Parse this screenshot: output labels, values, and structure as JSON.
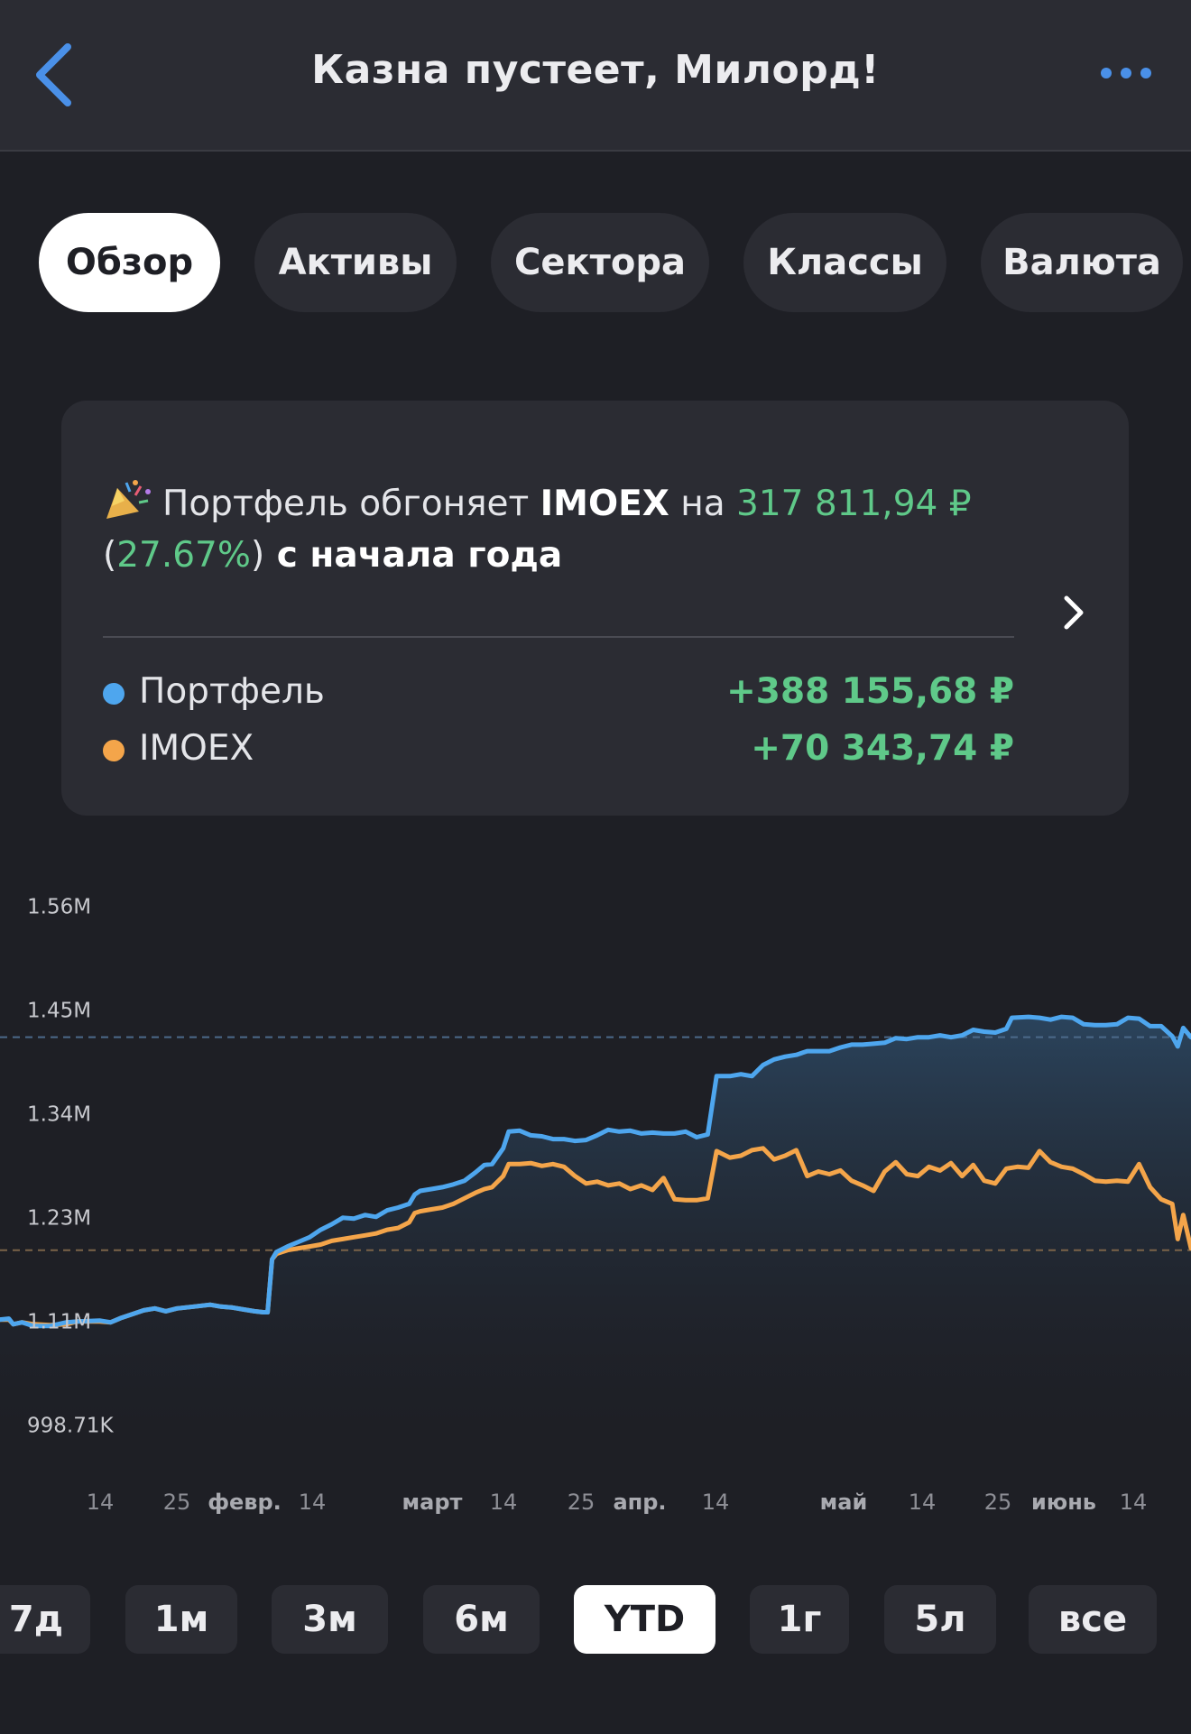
{
  "header": {
    "title": "Казна пустеет, Милорд!",
    "back_icon": "chevron-left-icon",
    "more_icon": "more-horizontal-icon"
  },
  "tabs": [
    {
      "label": "Обзор",
      "active": true
    },
    {
      "label": "Активы",
      "active": false
    },
    {
      "label": "Сектора",
      "active": false
    },
    {
      "label": "Классы",
      "active": false
    },
    {
      "label": "Валюта",
      "active": false
    }
  ],
  "summary": {
    "icon": "party-popper-icon",
    "prefix": "Портфель обгоняет ",
    "index": "IMOEX",
    "middle": " на ",
    "amount": "317 811,94 ₽",
    "open_paren": "(",
    "percent": "27.67%",
    "close_paren": ")",
    "suffix": " с начала года",
    "legend": [
      {
        "name": "Портфель",
        "value": "+388 155,68 ₽",
        "color": "#4ea6ee"
      },
      {
        "name": "IMOEX",
        "value": "+70 343,74 ₽",
        "color": "#f4a54a"
      }
    ]
  },
  "chart_data": {
    "type": "line",
    "y_ticks": [
      "1.56M",
      "1.45M",
      "1.34M",
      "1.23M",
      "1.11M",
      "998.71K"
    ],
    "x_ticks": [
      "14",
      "25",
      "февр.",
      "14",
      "март",
      "14",
      "25",
      "апр.",
      "14",
      "май",
      "14",
      "25",
      "июнь",
      "14"
    ],
    "ylim": [
      998710,
      1560000
    ],
    "reference_lines": [
      1420000,
      1190000
    ],
    "series": [
      {
        "name": "Портфель",
        "color": "#4ea6ee",
        "points": [
          [
            0,
            1115000
          ],
          [
            8,
            1116000
          ],
          [
            12,
            1110000
          ],
          [
            20,
            1112000
          ],
          [
            30,
            1108000
          ],
          [
            45,
            1108000
          ],
          [
            60,
            1112000
          ],
          [
            70,
            1113000
          ],
          [
            90,
            1114000
          ],
          [
            100,
            1112000
          ],
          [
            110,
            1117000
          ],
          [
            120,
            1121000
          ],
          [
            130,
            1125000
          ],
          [
            140,
            1127000
          ],
          [
            150,
            1124000
          ],
          [
            160,
            1127000
          ],
          [
            175,
            1129000
          ],
          [
            190,
            1131000
          ],
          [
            200,
            1129000
          ],
          [
            210,
            1128000
          ],
          [
            220,
            1126000
          ],
          [
            230,
            1124000
          ],
          [
            238,
            1123000
          ],
          [
            242,
            1123000
          ],
          [
            246,
            1180000
          ],
          [
            250,
            1188000
          ],
          [
            260,
            1194000
          ],
          [
            270,
            1199000
          ],
          [
            280,
            1204000
          ],
          [
            290,
            1212000
          ],
          [
            300,
            1218000
          ],
          [
            310,
            1225000
          ],
          [
            320,
            1224000
          ],
          [
            330,
            1228000
          ],
          [
            340,
            1226000
          ],
          [
            350,
            1233000
          ],
          [
            360,
            1236000
          ],
          [
            370,
            1240000
          ],
          [
            375,
            1250000
          ],
          [
            380,
            1254000
          ],
          [
            390,
            1256000
          ],
          [
            400,
            1258000
          ],
          [
            410,
            1261000
          ],
          [
            420,
            1265000
          ],
          [
            430,
            1274000
          ],
          [
            438,
            1282000
          ],
          [
            445,
            1283000
          ],
          [
            455,
            1300000
          ],
          [
            460,
            1318000
          ],
          [
            470,
            1319000
          ],
          [
            480,
            1314000
          ],
          [
            490,
            1313000
          ],
          [
            500,
            1310000
          ],
          [
            510,
            1310000
          ],
          [
            520,
            1308000
          ],
          [
            530,
            1309000
          ],
          [
            540,
            1314000
          ],
          [
            550,
            1320000
          ],
          [
            560,
            1318000
          ],
          [
            570,
            1319000
          ],
          [
            580,
            1316000
          ],
          [
            590,
            1317000
          ],
          [
            600,
            1316000
          ],
          [
            610,
            1316000
          ],
          [
            620,
            1318000
          ],
          [
            630,
            1312000
          ],
          [
            640,
            1315000
          ],
          [
            648,
            1378000
          ],
          [
            660,
            1378000
          ],
          [
            670,
            1380000
          ],
          [
            680,
            1378000
          ],
          [
            690,
            1390000
          ],
          [
            700,
            1396000
          ],
          [
            710,
            1399000
          ],
          [
            720,
            1401000
          ],
          [
            730,
            1405000
          ],
          [
            740,
            1405000
          ],
          [
            750,
            1405000
          ],
          [
            760,
            1409000
          ],
          [
            770,
            1412000
          ],
          [
            780,
            1412000
          ],
          [
            790,
            1413000
          ],
          [
            800,
            1414000
          ],
          [
            810,
            1419000
          ],
          [
            820,
            1418000
          ],
          [
            830,
            1420000
          ],
          [
            840,
            1420000
          ],
          [
            850,
            1422000
          ],
          [
            860,
            1420000
          ],
          [
            870,
            1422000
          ],
          [
            880,
            1428000
          ],
          [
            890,
            1426000
          ],
          [
            900,
            1425000
          ],
          [
            910,
            1429000
          ],
          [
            915,
            1441000
          ],
          [
            930,
            1442000
          ],
          [
            940,
            1441000
          ],
          [
            950,
            1439000
          ],
          [
            960,
            1442000
          ],
          [
            970,
            1441000
          ],
          [
            980,
            1434000
          ],
          [
            990,
            1433000
          ],
          [
            1000,
            1433000
          ],
          [
            1010,
            1434000
          ],
          [
            1020,
            1441000
          ],
          [
            1030,
            1440000
          ],
          [
            1040,
            1432000
          ],
          [
            1050,
            1432000
          ],
          [
            1060,
            1421000
          ],
          [
            1065,
            1410000
          ],
          [
            1070,
            1430000
          ],
          [
            1077,
            1420000
          ]
        ]
      },
      {
        "name": "IMOEX",
        "color": "#f4a54a",
        "points": [
          [
            0,
            1115000
          ],
          [
            8,
            1115000
          ],
          [
            12,
            1110000
          ],
          [
            20,
            1112000
          ],
          [
            30,
            1110000
          ],
          [
            45,
            1109000
          ],
          [
            60,
            1110000
          ],
          [
            70,
            1113000
          ],
          [
            90,
            1113000
          ],
          [
            100,
            1112000
          ],
          [
            110,
            1117000
          ],
          [
            120,
            1121000
          ],
          [
            130,
            1125000
          ],
          [
            140,
            1127000
          ],
          [
            150,
            1124000
          ],
          [
            160,
            1127000
          ],
          [
            175,
            1129000
          ],
          [
            190,
            1131000
          ],
          [
            200,
            1129000
          ],
          [
            210,
            1128000
          ],
          [
            220,
            1126000
          ],
          [
            230,
            1124000
          ],
          [
            238,
            1123000
          ],
          [
            242,
            1123000
          ],
          [
            246,
            1180000
          ],
          [
            250,
            1186000
          ],
          [
            260,
            1190000
          ],
          [
            270,
            1192000
          ],
          [
            280,
            1194000
          ],
          [
            290,
            1196000
          ],
          [
            300,
            1200000
          ],
          [
            310,
            1202000
          ],
          [
            320,
            1204000
          ],
          [
            330,
            1206000
          ],
          [
            340,
            1208000
          ],
          [
            350,
            1212000
          ],
          [
            360,
            1214000
          ],
          [
            370,
            1220000
          ],
          [
            375,
            1230000
          ],
          [
            380,
            1232000
          ],
          [
            390,
            1234000
          ],
          [
            400,
            1236000
          ],
          [
            410,
            1240000
          ],
          [
            420,
            1246000
          ],
          [
            430,
            1252000
          ],
          [
            438,
            1256000
          ],
          [
            445,
            1258000
          ],
          [
            455,
            1270000
          ],
          [
            460,
            1283000
          ],
          [
            470,
            1283000
          ],
          [
            480,
            1284000
          ],
          [
            490,
            1281000
          ],
          [
            500,
            1283000
          ],
          [
            510,
            1280000
          ],
          [
            520,
            1270000
          ],
          [
            530,
            1262000
          ],
          [
            540,
            1264000
          ],
          [
            550,
            1260000
          ],
          [
            560,
            1262000
          ],
          [
            570,
            1256000
          ],
          [
            580,
            1260000
          ],
          [
            590,
            1255000
          ],
          [
            600,
            1268000
          ],
          [
            610,
            1245000
          ],
          [
            620,
            1244000
          ],
          [
            630,
            1244000
          ],
          [
            640,
            1246000
          ],
          [
            648,
            1297000
          ],
          [
            660,
            1290000
          ],
          [
            670,
            1292000
          ],
          [
            680,
            1298000
          ],
          [
            690,
            1300000
          ],
          [
            700,
            1288000
          ],
          [
            710,
            1292000
          ],
          [
            720,
            1298000
          ],
          [
            730,
            1270000
          ],
          [
            740,
            1275000
          ],
          [
            750,
            1272000
          ],
          [
            760,
            1276000
          ],
          [
            770,
            1265000
          ],
          [
            780,
            1260000
          ],
          [
            790,
            1254000
          ],
          [
            800,
            1275000
          ],
          [
            810,
            1285000
          ],
          [
            820,
            1272000
          ],
          [
            830,
            1270000
          ],
          [
            840,
            1280000
          ],
          [
            850,
            1276000
          ],
          [
            860,
            1284000
          ],
          [
            870,
            1270000
          ],
          [
            880,
            1282000
          ],
          [
            890,
            1265000
          ],
          [
            900,
            1262000
          ],
          [
            910,
            1278000
          ],
          [
            920,
            1280000
          ],
          [
            930,
            1279000
          ],
          [
            940,
            1297000
          ],
          [
            950,
            1285000
          ],
          [
            960,
            1280000
          ],
          [
            970,
            1278000
          ],
          [
            980,
            1272000
          ],
          [
            990,
            1265000
          ],
          [
            1000,
            1264000
          ],
          [
            1010,
            1265000
          ],
          [
            1020,
            1264000
          ],
          [
            1030,
            1283000
          ],
          [
            1040,
            1258000
          ],
          [
            1050,
            1245000
          ],
          [
            1060,
            1240000
          ],
          [
            1065,
            1202000
          ],
          [
            1070,
            1228000
          ],
          [
            1077,
            1192000
          ]
        ]
      }
    ]
  },
  "periods": [
    {
      "label": "7д",
      "active": false
    },
    {
      "label": "1м",
      "active": false
    },
    {
      "label": "3м",
      "active": false
    },
    {
      "label": "6м",
      "active": false
    },
    {
      "label": "YTD",
      "active": true
    },
    {
      "label": "1г",
      "active": false
    },
    {
      "label": "5л",
      "active": false
    },
    {
      "label": "все",
      "active": false
    }
  ]
}
